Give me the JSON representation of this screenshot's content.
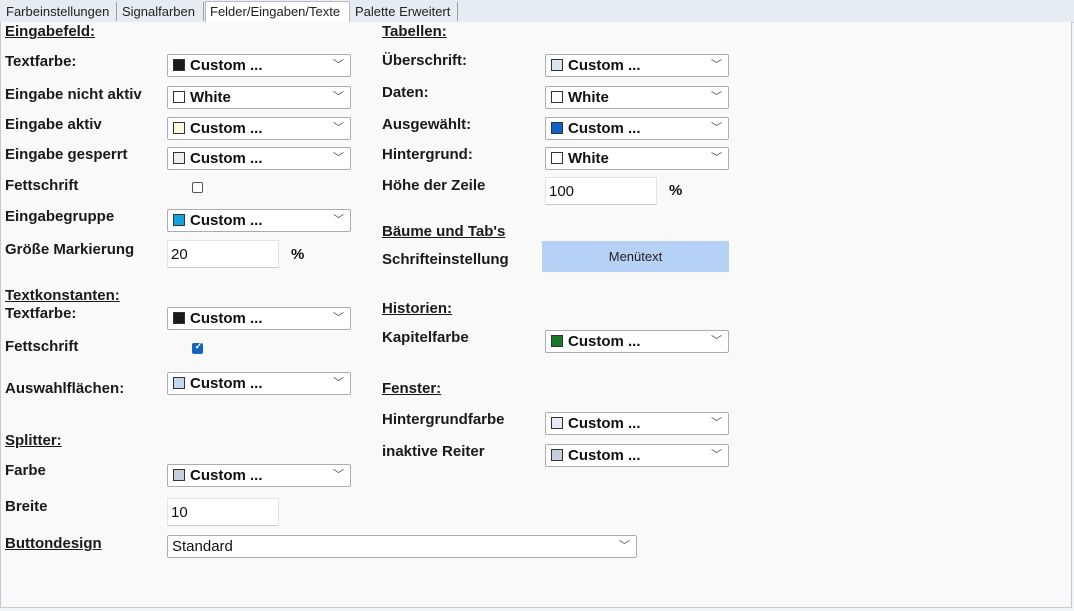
{
  "tabs": [
    "Farbeinstellungen",
    "Signalfarben",
    "Felder/Eingaben/Texte",
    "Palette Erweitert"
  ],
  "active_tab": "Felder/Eingaben/Texte",
  "eingabefeld": {
    "header": "Eingabefeld:",
    "textfarbe_label": "Textfarbe:",
    "textfarbe_value": "Custom ...",
    "textfarbe_color": "#1a1a1a",
    "nicht_aktiv_label": "Eingabe nicht aktiv",
    "nicht_aktiv_value": "White",
    "nicht_aktiv_color": "#ffffff",
    "aktiv_label": "Eingabe aktiv",
    "aktiv_value": "Custom ...",
    "aktiv_color": "#fbf6dc",
    "gesperrt_label": "Eingabe gesperrt",
    "gesperrt_value": "Custom ...",
    "gesperrt_color": "#eeeeee",
    "fettschrift_label": "Fettschrift",
    "fettschrift_checked": false,
    "gruppe_label": "Eingabegruppe",
    "gruppe_value": "Custom ...",
    "gruppe_color": "#13a4e0",
    "markierung_label": "Größe Markierung",
    "markierung_value": "20",
    "markierung_unit": "%"
  },
  "textkonstanten": {
    "header": "Textkonstanten:",
    "textfarbe_label": "Textfarbe:",
    "textfarbe_value": "Custom ...",
    "textfarbe_color": "#1a1a1a",
    "fettschrift_label": "Fettschrift",
    "fettschrift_checked": true,
    "check_glyph": "✓",
    "auswahl_label": "Auswahlflächen:",
    "auswahl_value": "Custom ...",
    "auswahl_color": "#c6d6f0"
  },
  "splitter": {
    "header": "Splitter:",
    "farbe_label": "Farbe",
    "farbe_value": "Custom ...",
    "farbe_color": "#c6cfdc",
    "breite_label": "Breite",
    "breite_value": "10"
  },
  "buttondesign": {
    "label": "Buttondesign",
    "value": "Standard"
  },
  "tabellen": {
    "header": "Tabellen:",
    "ueberschrift_label": "Überschrift:",
    "ueberschrift_value": "Custom ...",
    "ueberschrift_color": "#dde4ee",
    "daten_label": "Daten:",
    "daten_value": "White",
    "daten_color": "#ffffff",
    "ausgewaehlt_label": "Ausgewählt:",
    "ausgewaehlt_value": "Custom ...",
    "ausgewaehlt_color": "#0a63c6",
    "hintergrund_label": "Hintergrund:",
    "hintergrund_value": "White",
    "hintergrund_color": "#ffffff",
    "zeile_label": "Höhe der Zeile",
    "zeile_value": "100",
    "zeile_unit": "%"
  },
  "baeume": {
    "header": "Bäume und Tab's",
    "schrift_label": "Schrifteinstellung",
    "schrift_button": "Menütext"
  },
  "historien": {
    "header": "Historien:",
    "kapitel_label": "Kapitelfarbe",
    "kapitel_value": "Custom ...",
    "kapitel_color": "#1a7a24"
  },
  "fenster": {
    "header": "Fenster:",
    "hintergrund_label": "Hintergrundfarbe",
    "hintergrund_value": "Custom ...",
    "hintergrund_color": "#e6ebf2",
    "reiter_label": "inaktive Reiter",
    "reiter_value": "Custom ...",
    "reiter_color": "#c6d0dc"
  },
  "icons": {
    "dropdown": "chevron-down-icon",
    "checkbox": "check-icon"
  }
}
